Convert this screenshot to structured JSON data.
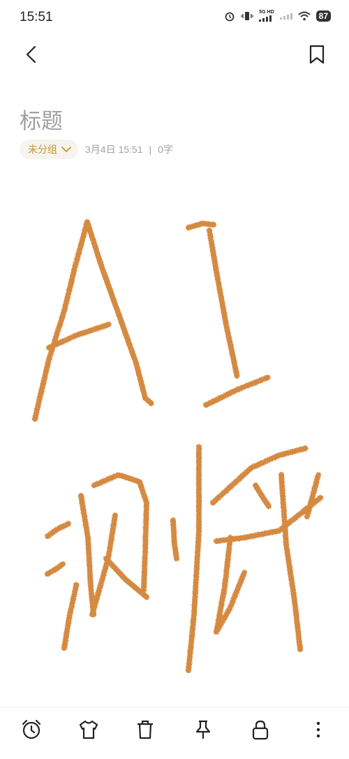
{
  "status_bar": {
    "time": "15:51",
    "network": "5G HD",
    "battery": "87"
  },
  "note": {
    "title": "标题",
    "group": "未分组",
    "date": "3月4日 15:51",
    "separator": "|",
    "word_count": "0字"
  },
  "drawing": {
    "handwritten_text": "AI 测评",
    "stroke_color": "#d58a42"
  },
  "icons": {
    "back": "chevron-left-icon",
    "bookmark": "bookmark-icon",
    "toolbar": [
      "alarm-clock-icon",
      "shirt-icon",
      "trash-icon",
      "pin-icon",
      "lock-icon",
      "more-vertical-icon"
    ]
  },
  "colors": {
    "accent": "#c4952e",
    "chip_background": "#f6f4ef",
    "title_gray": "#a0a0a0"
  }
}
